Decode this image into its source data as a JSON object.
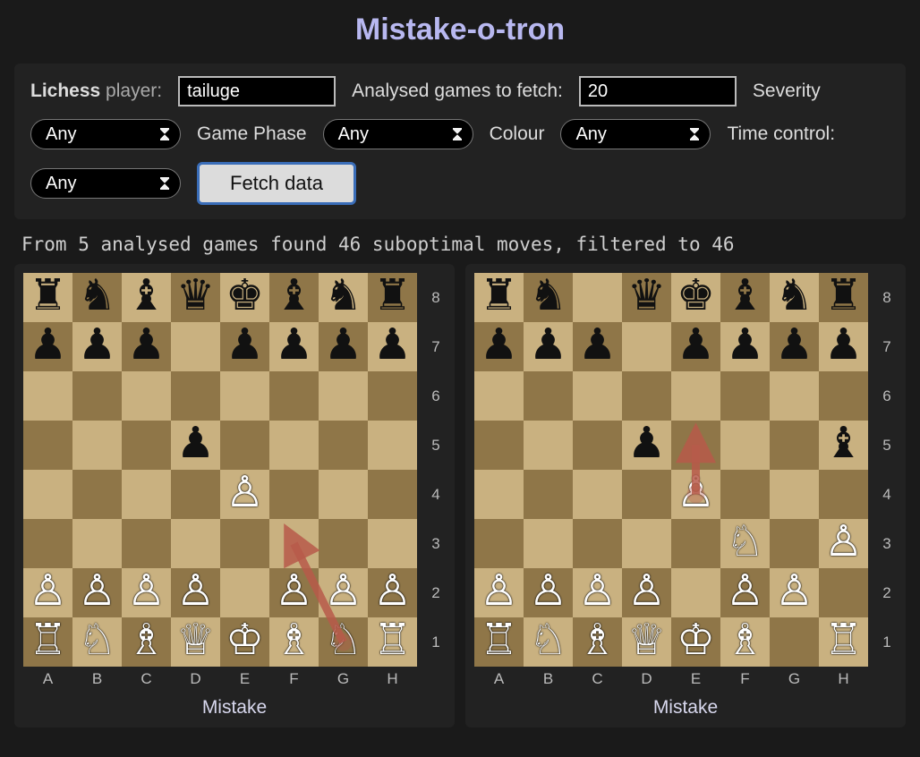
{
  "title": "Mistake-o-tron",
  "controls": {
    "player_label_strong": "Lichess",
    "player_label_rest": " player:",
    "player_value": "tailuge",
    "games_label": "Analysed games to fetch:",
    "games_value": "20",
    "severity_label": "Severity",
    "severity_value": "Any",
    "phase_label": "Game Phase",
    "phase_value": "Any",
    "colour_label": "Colour",
    "colour_value": "Any",
    "tc_label": "Time control:",
    "tc_value": "Any",
    "fetch_label": "Fetch data"
  },
  "status": "From 5 analysed games found 46 suboptimal moves, filtered to 46",
  "files": [
    "A",
    "B",
    "C",
    "D",
    "E",
    "F",
    "G",
    "H"
  ],
  "ranks": [
    "8",
    "7",
    "6",
    "5",
    "4",
    "3",
    "2",
    "1"
  ],
  "boards": [
    {
      "caption": "Mistake",
      "pieces": [
        {
          "sq": "a8",
          "p": "r",
          "c": "b"
        },
        {
          "sq": "b8",
          "p": "n",
          "c": "b"
        },
        {
          "sq": "c8",
          "p": "b",
          "c": "b"
        },
        {
          "sq": "d8",
          "p": "q",
          "c": "b"
        },
        {
          "sq": "e8",
          "p": "k",
          "c": "b"
        },
        {
          "sq": "f8",
          "p": "b",
          "c": "b"
        },
        {
          "sq": "g8",
          "p": "n",
          "c": "b"
        },
        {
          "sq": "h8",
          "p": "r",
          "c": "b"
        },
        {
          "sq": "a7",
          "p": "p",
          "c": "b"
        },
        {
          "sq": "b7",
          "p": "p",
          "c": "b"
        },
        {
          "sq": "c7",
          "p": "p",
          "c": "b"
        },
        {
          "sq": "e7",
          "p": "p",
          "c": "b"
        },
        {
          "sq": "f7",
          "p": "p",
          "c": "b"
        },
        {
          "sq": "g7",
          "p": "p",
          "c": "b"
        },
        {
          "sq": "h7",
          "p": "p",
          "c": "b"
        },
        {
          "sq": "d5",
          "p": "p",
          "c": "b"
        },
        {
          "sq": "e4",
          "p": "p",
          "c": "w"
        },
        {
          "sq": "a2",
          "p": "p",
          "c": "w"
        },
        {
          "sq": "b2",
          "p": "p",
          "c": "w"
        },
        {
          "sq": "c2",
          "p": "p",
          "c": "w"
        },
        {
          "sq": "d2",
          "p": "p",
          "c": "w"
        },
        {
          "sq": "f2",
          "p": "p",
          "c": "w"
        },
        {
          "sq": "g2",
          "p": "p",
          "c": "w"
        },
        {
          "sq": "h2",
          "p": "p",
          "c": "w"
        },
        {
          "sq": "a1",
          "p": "r",
          "c": "w"
        },
        {
          "sq": "b1",
          "p": "n",
          "c": "w"
        },
        {
          "sq": "c1",
          "p": "b",
          "c": "w"
        },
        {
          "sq": "d1",
          "p": "q",
          "c": "w"
        },
        {
          "sq": "e1",
          "p": "k",
          "c": "w"
        },
        {
          "sq": "f1",
          "p": "b",
          "c": "w"
        },
        {
          "sq": "g1",
          "p": "n",
          "c": "w"
        },
        {
          "sq": "h1",
          "p": "r",
          "c": "w"
        }
      ],
      "arrow": {
        "from": "g1",
        "to": "f3"
      }
    },
    {
      "caption": "Mistake",
      "pieces": [
        {
          "sq": "a8",
          "p": "r",
          "c": "b"
        },
        {
          "sq": "b8",
          "p": "n",
          "c": "b"
        },
        {
          "sq": "d8",
          "p": "q",
          "c": "b"
        },
        {
          "sq": "e8",
          "p": "k",
          "c": "b"
        },
        {
          "sq": "f8",
          "p": "b",
          "c": "b"
        },
        {
          "sq": "g8",
          "p": "n",
          "c": "b"
        },
        {
          "sq": "h8",
          "p": "r",
          "c": "b"
        },
        {
          "sq": "a7",
          "p": "p",
          "c": "b"
        },
        {
          "sq": "b7",
          "p": "p",
          "c": "b"
        },
        {
          "sq": "c7",
          "p": "p",
          "c": "b"
        },
        {
          "sq": "e7",
          "p": "p",
          "c": "b"
        },
        {
          "sq": "f7",
          "p": "p",
          "c": "b"
        },
        {
          "sq": "g7",
          "p": "p",
          "c": "b"
        },
        {
          "sq": "h7",
          "p": "p",
          "c": "b"
        },
        {
          "sq": "d5",
          "p": "p",
          "c": "b"
        },
        {
          "sq": "h5",
          "p": "b",
          "c": "b"
        },
        {
          "sq": "e4",
          "p": "p",
          "c": "w"
        },
        {
          "sq": "f3",
          "p": "n",
          "c": "w"
        },
        {
          "sq": "h3",
          "p": "p",
          "c": "w"
        },
        {
          "sq": "a2",
          "p": "p",
          "c": "w"
        },
        {
          "sq": "b2",
          "p": "p",
          "c": "w"
        },
        {
          "sq": "c2",
          "p": "p",
          "c": "w"
        },
        {
          "sq": "d2",
          "p": "p",
          "c": "w"
        },
        {
          "sq": "f2",
          "p": "p",
          "c": "w"
        },
        {
          "sq": "g2",
          "p": "p",
          "c": "w"
        },
        {
          "sq": "a1",
          "p": "r",
          "c": "w"
        },
        {
          "sq": "b1",
          "p": "n",
          "c": "w"
        },
        {
          "sq": "c1",
          "p": "b",
          "c": "w"
        },
        {
          "sq": "d1",
          "p": "q",
          "c": "w"
        },
        {
          "sq": "e1",
          "p": "k",
          "c": "w"
        },
        {
          "sq": "f1",
          "p": "b",
          "c": "w"
        },
        {
          "sq": "h1",
          "p": "r",
          "c": "w"
        }
      ],
      "arrow": {
        "from": "e4",
        "to": "e5"
      }
    }
  ],
  "piece_glyphs": {
    "wk": "♔",
    "wq": "♕",
    "wr": "♖",
    "wb": "♗",
    "wn": "♘",
    "wp": "♙",
    "bk": "♚",
    "bq": "♛",
    "br": "♜",
    "bb": "♝",
    "bn": "♞",
    "bp": "♟"
  },
  "colors": {
    "arrow": "#b75a4a"
  }
}
